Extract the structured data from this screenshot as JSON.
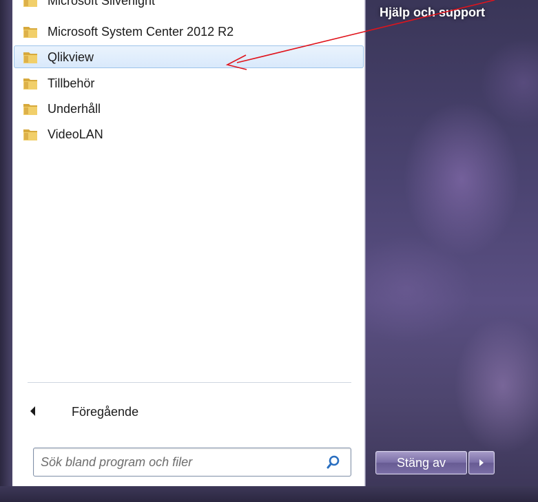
{
  "start_menu": {
    "programs": [
      {
        "label": "Microsoft Silverlight",
        "icon": "folder-icon",
        "selected": false
      },
      {
        "label": "Microsoft System Center 2012 R2",
        "icon": "folder-icon",
        "selected": false
      },
      {
        "label": "Qlikview",
        "icon": "folder-icon",
        "selected": true
      },
      {
        "label": "Tillbehör",
        "icon": "folder-icon",
        "selected": false
      },
      {
        "label": "Underhåll",
        "icon": "folder-icon",
        "selected": false
      },
      {
        "label": "VideoLAN",
        "icon": "folder-icon",
        "selected": false
      }
    ],
    "back_label": "Föregående",
    "search": {
      "placeholder": "Sök bland program och filer",
      "value": ""
    }
  },
  "right_pane": {
    "help_link": "Hjälp och support",
    "shutdown_label": "Stäng av"
  },
  "annotation": {
    "color": "#e0141c"
  },
  "colors": {
    "selection_bg": "#d9e9fb",
    "selection_border": "#9cc3ea",
    "folder": "#e8c35a"
  }
}
